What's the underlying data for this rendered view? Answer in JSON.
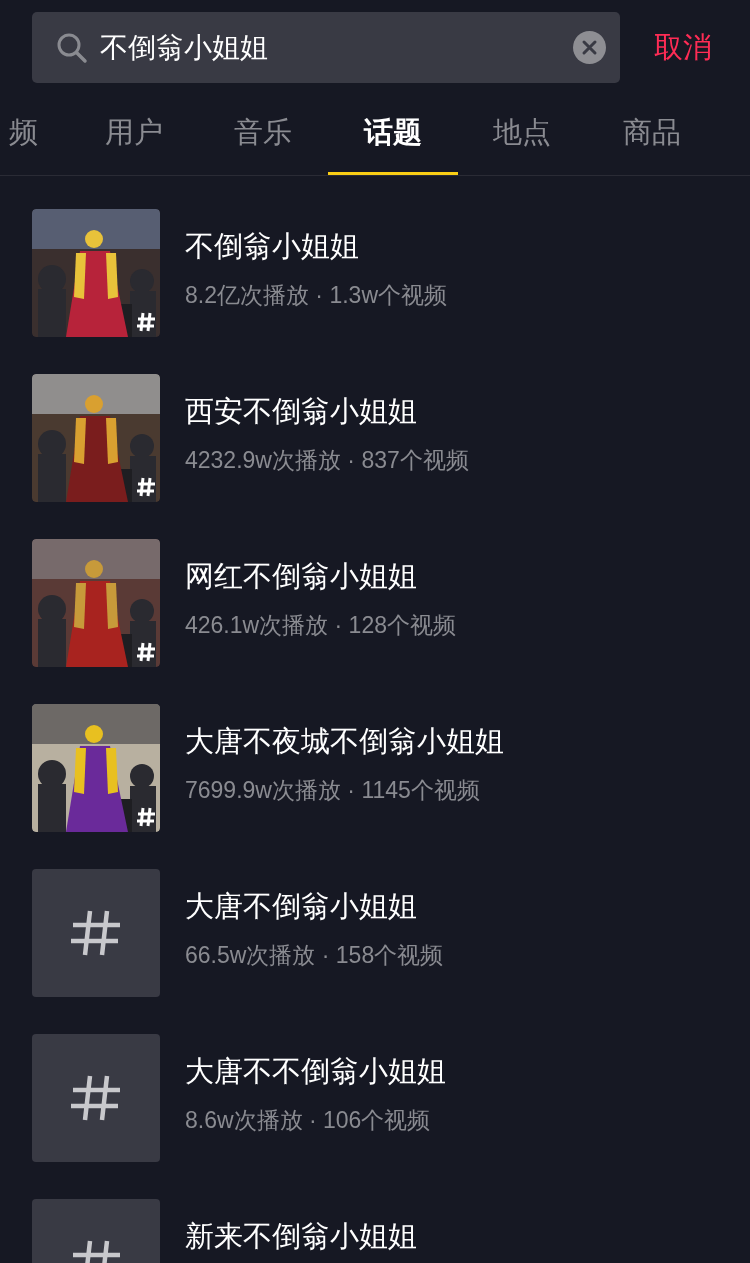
{
  "search": {
    "value": "不倒翁小姐姐",
    "cancel": "取消"
  },
  "tabs": [
    {
      "label": "频",
      "selected": false
    },
    {
      "label": "用户",
      "selected": false
    },
    {
      "label": "音乐",
      "selected": false
    },
    {
      "label": "话题",
      "selected": true
    },
    {
      "label": "地点",
      "selected": false
    },
    {
      "label": "商品",
      "selected": false
    }
  ],
  "topics": [
    {
      "kind": "picture",
      "title": "不倒翁小姐姐",
      "stats": "8.2亿次播放 · 1.3w个视频"
    },
    {
      "kind": "picture",
      "title": "西安不倒翁小姐姐",
      "stats": "4232.9w次播放 · 837个视频"
    },
    {
      "kind": "picture",
      "title": "网红不倒翁小姐姐",
      "stats": "426.1w次播放 · 128个视频"
    },
    {
      "kind": "picture",
      "title": "大唐不夜城不倒翁小姐姐",
      "stats": "7699.9w次播放 · 1145个视频"
    },
    {
      "kind": "placeholder",
      "title": "大唐不倒翁小姐姐",
      "stats": "66.5w次播放 · 158个视频"
    },
    {
      "kind": "placeholder",
      "title": "大唐不不倒翁小姐姐",
      "stats": "8.6w次播放 · 106个视频"
    },
    {
      "kind": "placeholder",
      "title": "新来不倒翁小姐姐"
    }
  ]
}
